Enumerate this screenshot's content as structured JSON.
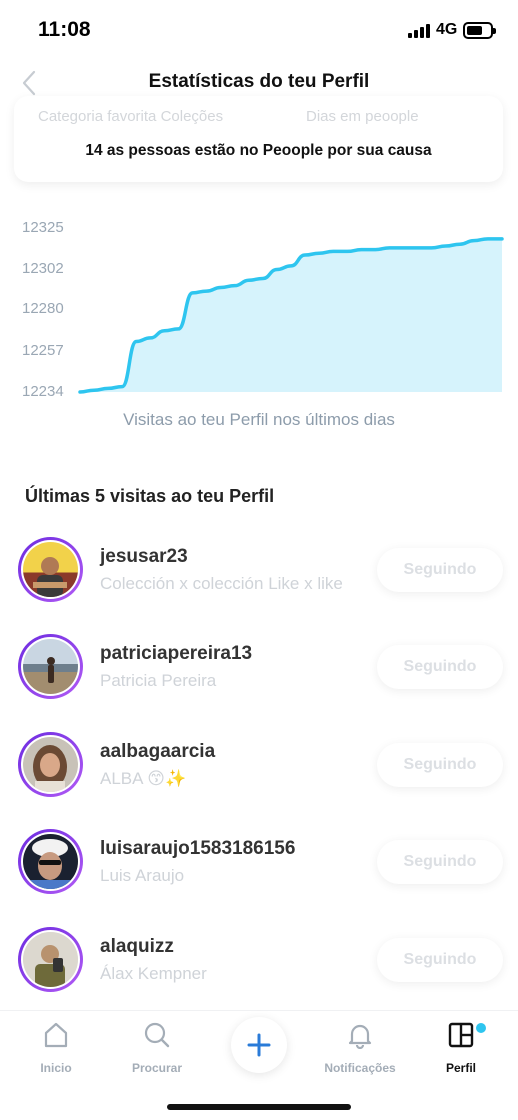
{
  "status_bar": {
    "time": "11:08",
    "network": "4G"
  },
  "header": {
    "title": "Estatísticas do teu Perfil",
    "back_icon": "chevron-left-icon"
  },
  "stats_card": {
    "faded_label_left": "Categoria favorita Coleções",
    "faded_label_right": "Dias em peoople",
    "cause_text": "14 as pessoas estão no Peoople por sua causa"
  },
  "chart_data": {
    "type": "area",
    "title": "",
    "caption": "Visitas ao teu Perfil nos últimos dias",
    "ylabel": "",
    "xlabel": "",
    "ylim": [
      12234,
      12325
    ],
    "y_ticks": [
      "12325",
      "12302",
      "12280",
      "12257",
      "12234"
    ],
    "y_tick_values": [
      12325,
      12302,
      12280,
      12257,
      12234
    ],
    "grid": false,
    "color": "#2ec5ef",
    "fill_color": "#d6f3fc",
    "series": [
      {
        "values": [
          12234,
          12235,
          12236,
          12237,
          12262,
          12264,
          12268,
          12269,
          12289,
          12290,
          12292,
          12293,
          12296,
          12297,
          12302,
          12304,
          12310,
          12311,
          12312,
          12312,
          12313,
          12313,
          12314,
          12314,
          12314,
          12314,
          12315,
          12316,
          12318,
          12319,
          12319
        ]
      }
    ]
  },
  "visits": {
    "title": "Últimas 5 visitas ao teu Perfil",
    "follow_label": "Seguindo",
    "items": [
      {
        "username": "jesusar23",
        "subtitle": "Colección x colección Like x like"
      },
      {
        "username": "patriciapereira13",
        "subtitle": "Patricia Pereira"
      },
      {
        "username": "aalbagaarcia",
        "subtitle": "ALBA 😙✨"
      },
      {
        "username": "luisaraujo1583186156",
        "subtitle": "Luis Araujo"
      },
      {
        "username": "alaquizz",
        "subtitle": "Álax Kempner"
      }
    ]
  },
  "tabbar": {
    "tabs": [
      {
        "label": "Inicio",
        "icon": "home-icon"
      },
      {
        "label": "Procurar",
        "icon": "search-icon"
      },
      {
        "label": "",
        "icon": "plus-icon"
      },
      {
        "label": "Notificações",
        "icon": "bell-icon"
      },
      {
        "label": "Perfil",
        "icon": "grid-icon"
      }
    ],
    "active_color": "#111111",
    "accent": "#2ec5ef"
  }
}
